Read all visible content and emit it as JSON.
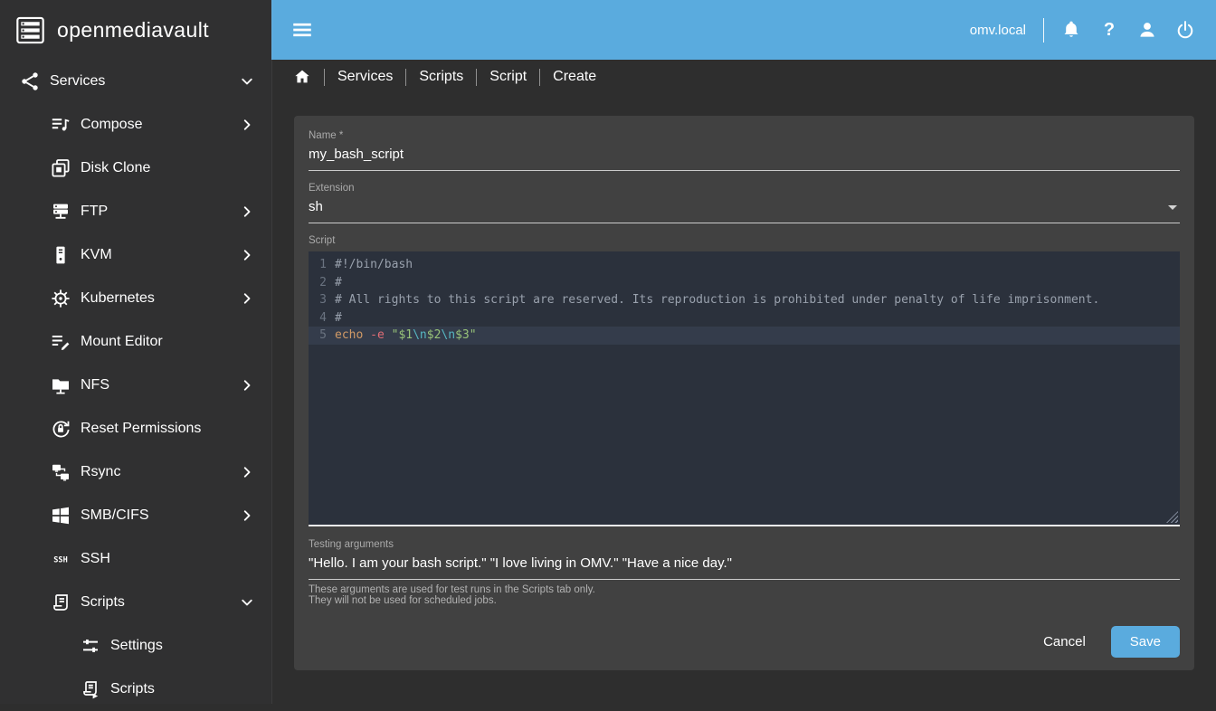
{
  "brand": {
    "name": "openmediavault",
    "logo_icon": "omv-logo-icon"
  },
  "topbar": {
    "menu_icon": "menu-icon",
    "host": "omv.local",
    "icons": [
      "bell-icon",
      "help-icon",
      "person-icon",
      "power-icon"
    ]
  },
  "breadcrumb": {
    "home_icon": "home-icon",
    "items": [
      "Services",
      "Scripts",
      "Script",
      "Create"
    ]
  },
  "sidebar": {
    "items": [
      {
        "label": "Services",
        "icon": "share-icon",
        "chevron": "down",
        "level": 0
      },
      {
        "label": "Compose",
        "icon": "compose-icon",
        "chevron": "right",
        "level": 1
      },
      {
        "label": "Disk Clone",
        "icon": "disk-clone-icon",
        "chevron": null,
        "level": 1
      },
      {
        "label": "FTP",
        "icon": "ftp-icon",
        "chevron": "right",
        "level": 1
      },
      {
        "label": "KVM",
        "icon": "kvm-icon",
        "chevron": "right",
        "level": 1
      },
      {
        "label": "Kubernetes",
        "icon": "kubernetes-icon",
        "chevron": "right",
        "level": 1
      },
      {
        "label": "Mount Editor",
        "icon": "mount-editor-icon",
        "chevron": null,
        "level": 1
      },
      {
        "label": "NFS",
        "icon": "nfs-icon",
        "chevron": "right",
        "level": 1
      },
      {
        "label": "Reset Permissions",
        "icon": "reset-permissions-icon",
        "chevron": null,
        "level": 1
      },
      {
        "label": "Rsync",
        "icon": "rsync-icon",
        "chevron": "right",
        "level": 1
      },
      {
        "label": "SMB/CIFS",
        "icon": "smb-icon",
        "chevron": "right",
        "level": 1
      },
      {
        "label": "SSH",
        "icon": "ssh-icon",
        "chevron": null,
        "level": 1
      },
      {
        "label": "Scripts",
        "icon": "scripts-icon",
        "chevron": "down",
        "level": 1
      },
      {
        "label": "Settings",
        "icon": "tune-icon",
        "chevron": null,
        "level": 2
      },
      {
        "label": "Scripts",
        "icon": "script-run-icon",
        "chevron": null,
        "level": 2
      }
    ]
  },
  "form": {
    "name": {
      "label": "Name *",
      "value": "my_bash_script"
    },
    "extension": {
      "label": "Extension",
      "value": "sh"
    },
    "script": {
      "label": "Script"
    },
    "testing_arguments": {
      "label": "Testing arguments",
      "value": "\"Hello. I am your bash script.\" \"I love living in OMV.\" \"Have a nice day.\"",
      "hints": [
        "These arguments are used for test runs in the Scripts tab only.",
        "They will not be used for scheduled jobs."
      ]
    },
    "buttons": {
      "cancel": "Cancel",
      "save": "Save"
    }
  },
  "editor": {
    "active_line": 5,
    "lines": [
      {
        "num": 1,
        "tokens": [
          {
            "t": "#!/bin/bash",
            "c": "comment"
          }
        ]
      },
      {
        "num": 2,
        "tokens": [
          {
            "t": "#",
            "c": "comment"
          }
        ]
      },
      {
        "num": 3,
        "tokens": [
          {
            "t": "# All rights to this script are reserved. Its reproduction is prohibited under penalty of life imprisonment.",
            "c": "comment"
          }
        ]
      },
      {
        "num": 4,
        "tokens": [
          {
            "t": "#",
            "c": "comment"
          }
        ]
      },
      {
        "num": 5,
        "tokens": [
          {
            "t": "echo",
            "c": "builtin"
          },
          {
            "t": " ",
            "c": "plain"
          },
          {
            "t": "-e",
            "c": "flag"
          },
          {
            "t": " ",
            "c": "plain"
          },
          {
            "t": "\"$1",
            "c": "string"
          },
          {
            "t": "\\n",
            "c": "escape"
          },
          {
            "t": "$2",
            "c": "string"
          },
          {
            "t": "\\n",
            "c": "escape"
          },
          {
            "t": "$3\"",
            "c": "string"
          }
        ]
      }
    ]
  },
  "colors": {
    "accent_blue": "#5aabde",
    "sidebar_bg": "#303031",
    "page_bg": "#2e2e2e",
    "card_bg": "#414141",
    "editor_bg": "#2b313c",
    "editor_active_line": "#343c4b",
    "token_comment": "#99a1ad",
    "token_builtin": "#d19a66",
    "token_flag": "#e06c75",
    "token_string": "#98c379",
    "token_escape": "#56b6c2"
  }
}
